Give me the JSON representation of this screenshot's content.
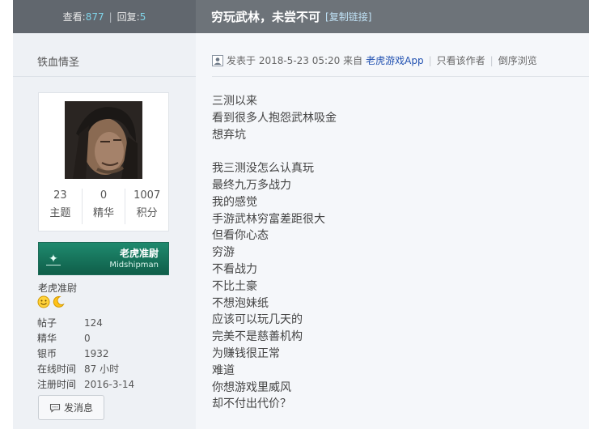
{
  "header": {
    "views_label": "查看:",
    "views": "877",
    "separator": "|",
    "replies_label": "回复:",
    "replies": "5",
    "title": "穷玩武林，未尝不可",
    "copy_link": "[复制链接]"
  },
  "author": {
    "name": "铁血情圣",
    "stats": [
      {
        "value": "23",
        "label": "主题"
      },
      {
        "value": "0",
        "label": "精华"
      },
      {
        "value": "1007",
        "label": "积分"
      }
    ],
    "rank_badge": {
      "cn": "老虎准尉",
      "en": "Midshipman",
      "color": "#1f8a6e"
    },
    "rank_title": "老虎准尉",
    "medals": [
      "smiley-medal-icon",
      "moon-medal-icon"
    ],
    "profile": [
      {
        "key": "帖子",
        "value": "124"
      },
      {
        "key": "精华",
        "value": "0"
      },
      {
        "key": "银币",
        "value": "1932"
      },
      {
        "key": "在线时间",
        "value": "87 小时"
      },
      {
        "key": "注册时间",
        "value": "2016-3-14"
      }
    ],
    "message_button": "发消息"
  },
  "post": {
    "posted_prefix": "发表于 2018-5-23 05:20 来自",
    "app": "老虎游戏App",
    "sep": "|",
    "only_author": "只看该作者",
    "reverse": "倒序浏览",
    "lines": [
      "三测以来",
      "看到很多人抱怨武林吸金",
      "想弃坑",
      "",
      "我三测没怎么认真玩",
      "最终九万多战力",
      "我的感觉",
      "手游武林穷富差距很大",
      "但看你心态",
      "穷游",
      "不看战力",
      "不比土豪",
      "不想泡妹纸",
      "应该可以玩几天的",
      "完美不是慈善机构",
      "为赚钱很正常",
      "难道",
      "你想游戏里威风",
      "却不付出代价？"
    ]
  }
}
